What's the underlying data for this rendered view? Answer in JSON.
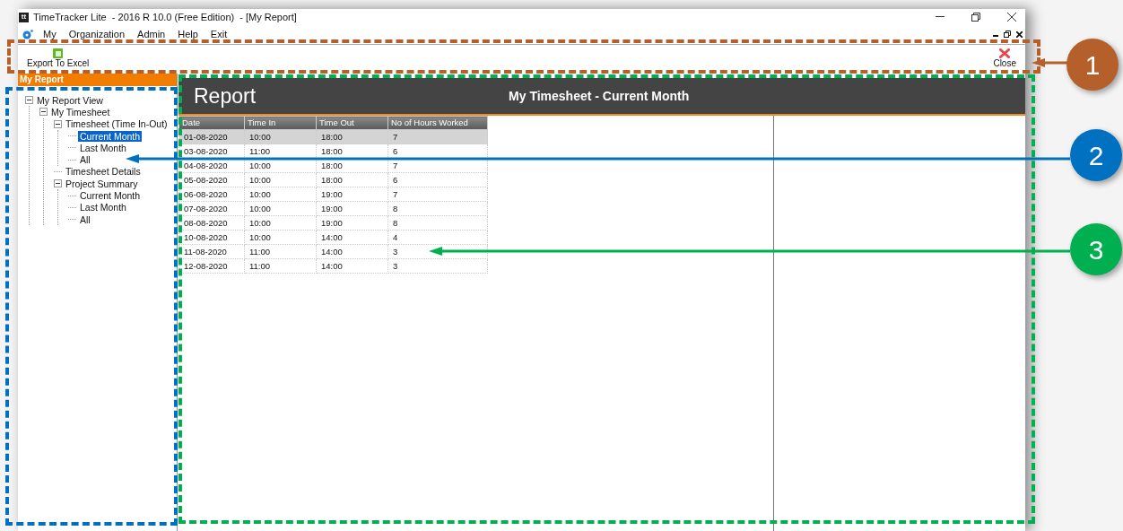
{
  "window": {
    "app_icon": "tt",
    "title": "TimeTracker Lite  - 2016 R 10.0 (Free Edition)  - [My Report]"
  },
  "menu": [
    "My",
    "Organization",
    "Admin",
    "Help",
    "Exit"
  ],
  "toolbar": [
    {
      "kind": "excel",
      "label": "Export To Excel"
    },
    {
      "kind": "close",
      "label": "Close"
    }
  ],
  "sidebar": {
    "header": "My Report",
    "tree": [
      {
        "label": "My Report View",
        "expanded": true,
        "selected": false,
        "children": [
          {
            "label": "My Timesheet",
            "expanded": true,
            "selected": false,
            "children": [
              {
                "label": "Timesheet (Time In-Out)",
                "expanded": true,
                "selected": false,
                "children": [
                  {
                    "label": "Current Month",
                    "selected": true
                  },
                  {
                    "label": "Last Month",
                    "selected": false
                  },
                  {
                    "label": "All",
                    "selected": false
                  }
                ]
              },
              {
                "label": "Timesheet Details",
                "selected": false
              },
              {
                "label": "Project Summary",
                "expanded": true,
                "selected": false,
                "children": [
                  {
                    "label": "Current Month",
                    "selected": false
                  },
                  {
                    "label": "Last Month",
                    "selected": false
                  },
                  {
                    "label": "All",
                    "selected": false
                  }
                ]
              }
            ]
          }
        ]
      }
    ]
  },
  "report": {
    "title": "Report",
    "subtitle": "My Timesheet - Current Month"
  },
  "table": {
    "columns": [
      "Date",
      "Time In",
      "Time Out",
      "No of Hours Worked"
    ],
    "rows": [
      {
        "cells": [
          "01-08-2020",
          "10:00",
          "18:00",
          "7"
        ],
        "selected": true
      },
      {
        "cells": [
          "03-08-2020",
          "11:00",
          "18:00",
          "6"
        ],
        "selected": false
      },
      {
        "cells": [
          "04-08-2020",
          "10:00",
          "18:00",
          "7"
        ],
        "selected": false
      },
      {
        "cells": [
          "05-08-2020",
          "10:00",
          "18:00",
          "6"
        ],
        "selected": false
      },
      {
        "cells": [
          "06-08-2020",
          "10:00",
          "19:00",
          "7"
        ],
        "selected": false
      },
      {
        "cells": [
          "07-08-2020",
          "10:00",
          "19:00",
          "8"
        ],
        "selected": false
      },
      {
        "cells": [
          "08-08-2020",
          "10:00",
          "19:00",
          "8"
        ],
        "selected": false
      },
      {
        "cells": [
          "10-08-2020",
          "10:00",
          "14:00",
          "4"
        ],
        "selected": false
      },
      {
        "cells": [
          "11-08-2020",
          "11:00",
          "14:00",
          "3"
        ],
        "selected": false
      },
      {
        "cells": [
          "12-08-2020",
          "11:00",
          "14:00",
          "3"
        ],
        "selected": false
      }
    ]
  },
  "callouts": [
    {
      "number": "1",
      "color": "#b5602a"
    },
    {
      "number": "2",
      "color": "#0070c0"
    },
    {
      "number": "3",
      "color": "#00b050"
    }
  ]
}
